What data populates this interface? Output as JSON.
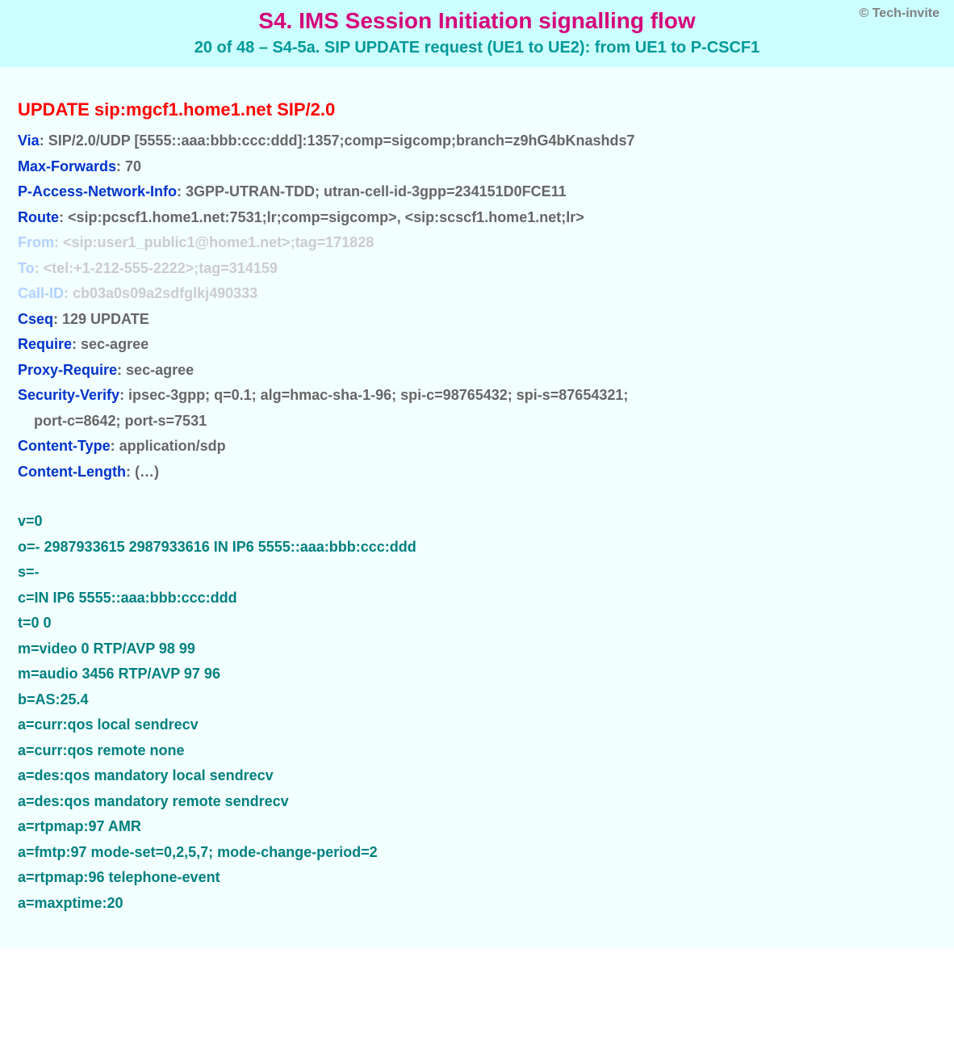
{
  "copyright": "© Tech-invite",
  "title1": "S4. IMS Session Initiation signalling flow",
  "title2": "20 of 48 – S4-5a. SIP UPDATE request (UE1 to UE2): from UE1 to P-CSCF1",
  "request_line": "UPDATE sip:mgcf1.home1.net SIP/2.0",
  "headers": {
    "via": {
      "name": "Via",
      "value": ": SIP/2.0/UDP [5555::aaa:bbb:ccc:ddd]:1357;comp=sigcomp;branch=z9hG4bKnashds7"
    },
    "max_forwards": {
      "name": "Max-Forwards",
      "value": ": 70"
    },
    "pani": {
      "name": "P-Access-Network-Info",
      "value": ": 3GPP-UTRAN-TDD; utran-cell-id-3gpp=234151D0FCE11"
    },
    "route": {
      "name": "Route",
      "value": ": <sip:pcscf1.home1.net:7531;lr;comp=sigcomp>, <sip:scscf1.home1.net;lr>"
    },
    "from": {
      "name": "From",
      "value": ": <sip:user1_public1@home1.net>;tag=171828"
    },
    "to": {
      "name": "To",
      "value": ": <tel:+1-212-555-2222>;tag=314159"
    },
    "call_id": {
      "name": "Call-ID",
      "value": ": cb03a0s09a2sdfglkj490333"
    },
    "cseq": {
      "name": "Cseq",
      "value": ": 129 UPDATE"
    },
    "require": {
      "name": "Require",
      "value": ": sec-agree"
    },
    "proxy_require": {
      "name": "Proxy-Require",
      "value": ": sec-agree"
    },
    "sec_verify": {
      "name": "Security-Verify",
      "value": ": ipsec-3gpp; q=0.1; alg=hmac-sha-1-96; spi-c=98765432; spi-s=87654321;"
    },
    "sec_verify2": {
      "value": "port-c=8642; port-s=7531"
    },
    "content_type": {
      "name": "Content-Type",
      "value": ": application/sdp"
    },
    "content_len": {
      "name": "Content-Length",
      "value": ": (…)"
    }
  },
  "sdp": [
    "v=0",
    "o=- 2987933615 2987933616 IN IP6 5555::aaa:bbb:ccc:ddd",
    "s=-",
    "c=IN IP6 5555::aaa:bbb:ccc:ddd",
    "t=0 0",
    "m=video 0 RTP/AVP 98 99",
    "m=audio 3456 RTP/AVP 97 96",
    "b=AS:25.4",
    "a=curr:qos local sendrecv",
    "a=curr:qos remote none",
    "a=des:qos mandatory local sendrecv",
    "a=des:qos mandatory remote sendrecv",
    "a=rtpmap:97 AMR",
    "a=fmtp:97 mode-set=0,2,5,7; mode-change-period=2",
    "a=rtpmap:96 telephone-event",
    "a=maxptime:20"
  ]
}
